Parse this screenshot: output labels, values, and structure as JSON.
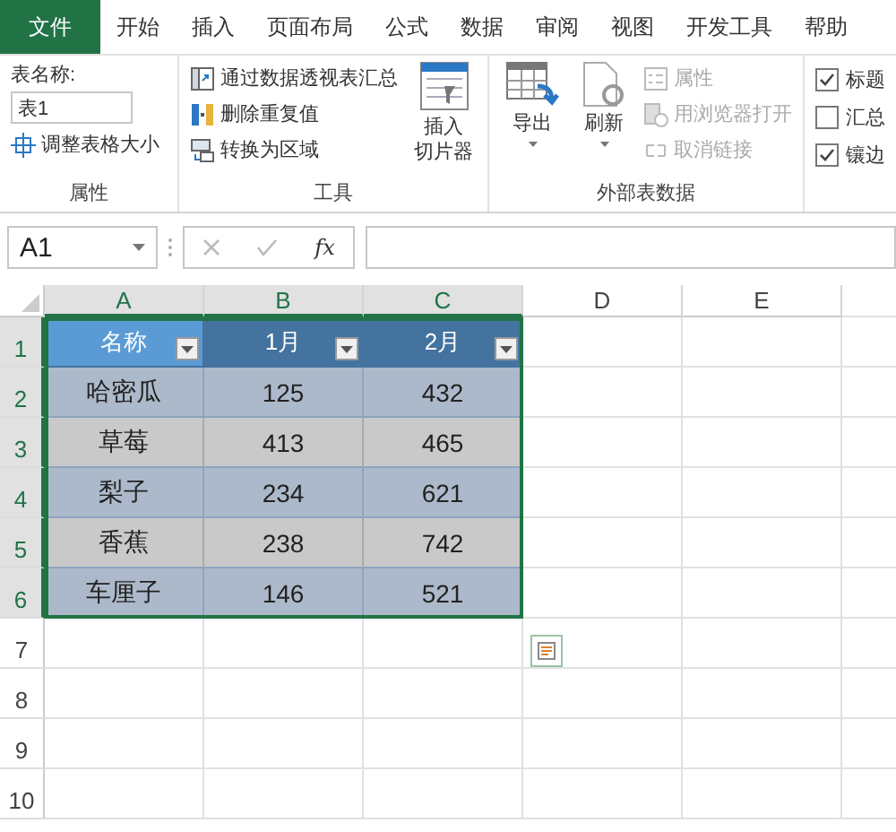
{
  "menu_tabs": [
    {
      "label": "文件",
      "selected": true
    },
    {
      "label": "开始",
      "selected": false
    },
    {
      "label": "插入",
      "selected": false
    },
    {
      "label": "页面布局",
      "selected": false
    },
    {
      "label": "公式",
      "selected": false
    },
    {
      "label": "数据",
      "selected": false
    },
    {
      "label": "审阅",
      "selected": false
    },
    {
      "label": "视图",
      "selected": false
    },
    {
      "label": "开发工具",
      "selected": false
    },
    {
      "label": "帮助",
      "selected": false
    }
  ],
  "ribbon": {
    "properties": {
      "table_name_label": "表名称:",
      "table_name": "表1",
      "resize": "调整表格大小",
      "label": "属性"
    },
    "tools": {
      "items": [
        "通过数据透视表汇总",
        "删除重复值",
        "转换为区域"
      ],
      "slicer": [
        "插入",
        "切片器"
      ],
      "label": "工具"
    },
    "external_data": {
      "export": "导出",
      "refresh": "刷新",
      "items": [
        {
          "label": "属性",
          "disabled": true
        },
        {
          "label": "用浏览器打开",
          "disabled": true
        },
        {
          "label": "取消链接",
          "disabled": true
        }
      ],
      "label": "外部表数据"
    },
    "style_options": [
      {
        "label": "标题",
        "checked": true
      },
      {
        "label": "汇总",
        "checked": false
      },
      {
        "label": "镶边",
        "checked": true
      }
    ]
  },
  "formula_bar": {
    "name_box": "A1",
    "function_symbol": "fx"
  },
  "columns": [
    {
      "label": "A",
      "selected": true
    },
    {
      "label": "B",
      "selected": true
    },
    {
      "label": "C",
      "selected": true
    },
    {
      "label": "D",
      "selected": false
    },
    {
      "label": "E",
      "selected": false
    }
  ],
  "rows": [
    {
      "label": "1",
      "selected": true
    },
    {
      "label": "2",
      "selected": true
    },
    {
      "label": "3",
      "selected": true
    },
    {
      "label": "4",
      "selected": true
    },
    {
      "label": "5",
      "selected": true
    },
    {
      "label": "6",
      "selected": true
    },
    {
      "label": "7",
      "selected": false
    },
    {
      "label": "8",
      "selected": false
    },
    {
      "label": "9",
      "selected": false
    },
    {
      "label": "10",
      "selected": false
    }
  ],
  "table": {
    "headers": [
      "名称",
      "1月",
      "2月"
    ],
    "rows": [
      [
        "哈密瓜",
        "125",
        "432"
      ],
      [
        "草莓",
        "413",
        "465"
      ],
      [
        "梨子",
        "234",
        "621"
      ],
      [
        "香蕉",
        "238",
        "742"
      ],
      [
        "车厘子",
        "146",
        "521"
      ]
    ]
  }
}
